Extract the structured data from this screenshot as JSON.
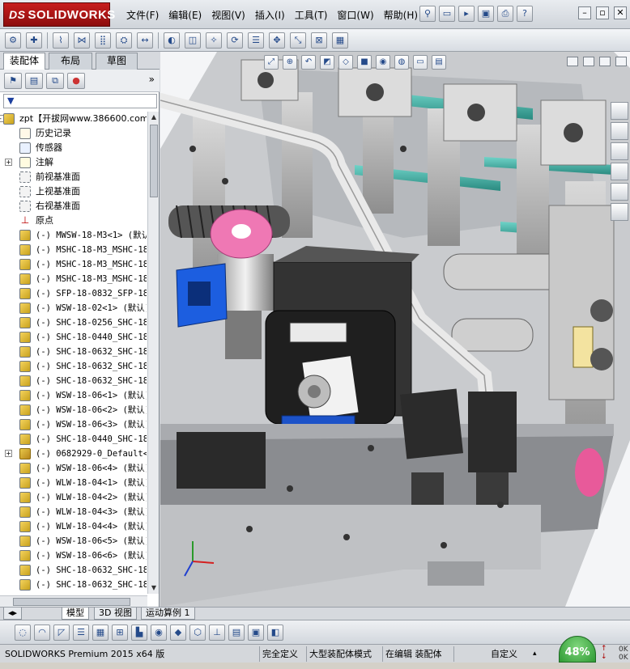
{
  "app": {
    "brand": "SOLIDWORKS",
    "brand_prefix": "DS"
  },
  "menu": [
    "文件(F)",
    "编辑(E)",
    "视图(V)",
    "插入(I)",
    "工具(T)",
    "窗口(W)",
    "帮助(H)"
  ],
  "quick_icons": [
    "pin-icon",
    "new-document-icon",
    "open-icon",
    "save-icon",
    "print-icon",
    "help-icon"
  ],
  "window_buttons": [
    "minimize",
    "restore",
    "close"
  ],
  "panel_tabs": [
    "装配体",
    "布局",
    "草图"
  ],
  "filter_symbol": "▼",
  "tree": [
    {
      "label": "zpt【开拔网www.386600.com】",
      "icon": "assembly-icon",
      "expand": "-",
      "indent": 0,
      "mono": false
    },
    {
      "label": "历史记录",
      "icon": "history-icon",
      "expand": "",
      "indent": 1,
      "mono": false
    },
    {
      "label": "传感器",
      "icon": "sensor-icon",
      "expand": "",
      "indent": 1,
      "mono": false
    },
    {
      "label": "注解",
      "icon": "annotation-icon",
      "expand": "+",
      "indent": 1,
      "mono": false
    },
    {
      "label": "前视基准面",
      "icon": "plane-icon",
      "expand": "",
      "indent": 1,
      "mono": false
    },
    {
      "label": "上视基准面",
      "icon": "plane-icon",
      "expand": "",
      "indent": 1,
      "mono": false
    },
    {
      "label": "右视基准面",
      "icon": "plane-icon",
      "expand": "",
      "indent": 1,
      "mono": false
    },
    {
      "label": "原点",
      "icon": "origin-icon",
      "expand": "",
      "indent": 1,
      "mono": false
    },
    {
      "label": "(-) MWSW-18-M3<1> (默认",
      "icon": "part-icon",
      "expand": "",
      "indent": 1,
      "mono": true
    },
    {
      "label": "(-) MSHC-18-M3_MSHC-18-",
      "icon": "part-icon",
      "expand": "",
      "indent": 1,
      "mono": true
    },
    {
      "label": "(-) MSHC-18-M3_MSHC-18-",
      "icon": "part-icon",
      "expand": "",
      "indent": 1,
      "mono": true
    },
    {
      "label": "(-) MSHC-18-M3_MSHC-18-",
      "icon": "part-icon",
      "expand": "",
      "indent": 1,
      "mono": true
    },
    {
      "label": "(-) SFP-18-0832_SFP-18-",
      "icon": "part-icon",
      "expand": "",
      "indent": 1,
      "mono": true
    },
    {
      "label": "(-) WSW-18-02<1> (默认)",
      "icon": "part-icon",
      "expand": "",
      "indent": 1,
      "mono": true
    },
    {
      "label": "(-) SHC-18-0256_SHC-18-",
      "icon": "part-icon",
      "expand": "",
      "indent": 1,
      "mono": true
    },
    {
      "label": "(-) SHC-18-0440_SHC-18-",
      "icon": "part-icon",
      "expand": "",
      "indent": 1,
      "mono": true
    },
    {
      "label": "(-) SHC-18-0632_SHC-18-",
      "icon": "part-icon",
      "expand": "",
      "indent": 1,
      "mono": true
    },
    {
      "label": "(-) SHC-18-0632_SHC-18-",
      "icon": "part-icon",
      "expand": "",
      "indent": 1,
      "mono": true
    },
    {
      "label": "(-) SHC-18-0632_SHC-18-",
      "icon": "part-icon",
      "expand": "",
      "indent": 1,
      "mono": true
    },
    {
      "label": "(-) WSW-18-06<1> (默认)",
      "icon": "part-icon",
      "expand": "",
      "indent": 1,
      "mono": true
    },
    {
      "label": "(-) WSW-18-06<2> (默认)",
      "icon": "part-icon",
      "expand": "",
      "indent": 1,
      "mono": true
    },
    {
      "label": "(-) WSW-18-06<3> (默认)",
      "icon": "part-icon",
      "expand": "",
      "indent": 1,
      "mono": true
    },
    {
      "label": "(-) SHC-18-0440_SHC-18-",
      "icon": "part-icon",
      "expand": "",
      "indent": 1,
      "mono": true
    },
    {
      "label": "(-) 0682929-0_Default<1",
      "icon": "subassembly-icon",
      "expand": "+",
      "indent": 1,
      "mono": true
    },
    {
      "label": "(-) WSW-18-06<4> (默认)",
      "icon": "part-icon",
      "expand": "",
      "indent": 1,
      "mono": true
    },
    {
      "label": "(-) WLW-18-04<1> (默认)",
      "icon": "part-icon",
      "expand": "",
      "indent": 1,
      "mono": true
    },
    {
      "label": "(-) WLW-18-04<2> (默认)",
      "icon": "part-icon",
      "expand": "",
      "indent": 1,
      "mono": true
    },
    {
      "label": "(-) WLW-18-04<3> (默认)",
      "icon": "part-icon",
      "expand": "",
      "indent": 1,
      "mono": true
    },
    {
      "label": "(-) WLW-18-04<4> (默认)",
      "icon": "part-icon",
      "expand": "",
      "indent": 1,
      "mono": true
    },
    {
      "label": "(-) WSW-18-06<5> (默认)",
      "icon": "part-icon",
      "expand": "",
      "indent": 1,
      "mono": true
    },
    {
      "label": "(-) WSW-18-06<6> (默认)",
      "icon": "part-icon",
      "expand": "",
      "indent": 1,
      "mono": true
    },
    {
      "label": "(-) SHC-18-0632_SHC-18-",
      "icon": "part-icon",
      "expand": "",
      "indent": 1,
      "mono": true
    },
    {
      "label": "(-) SHC-18-0632_SHC-18-",
      "icon": "part-icon",
      "expand": "",
      "indent": 1,
      "mono": true
    }
  ],
  "model_tabs": [
    "模型",
    "3D 视图",
    "运动算例 1"
  ],
  "status": {
    "product": "SOLIDWORKS Premium 2015 x64 版",
    "fully_defined": "完全定义",
    "large_assembly": "大型装配体模式",
    "editing": "在编辑 装配体",
    "custom": "自定义",
    "percent": "48%"
  },
  "colors": {
    "accent_red": "#c81e1e",
    "status_green": "#3aa63f"
  }
}
